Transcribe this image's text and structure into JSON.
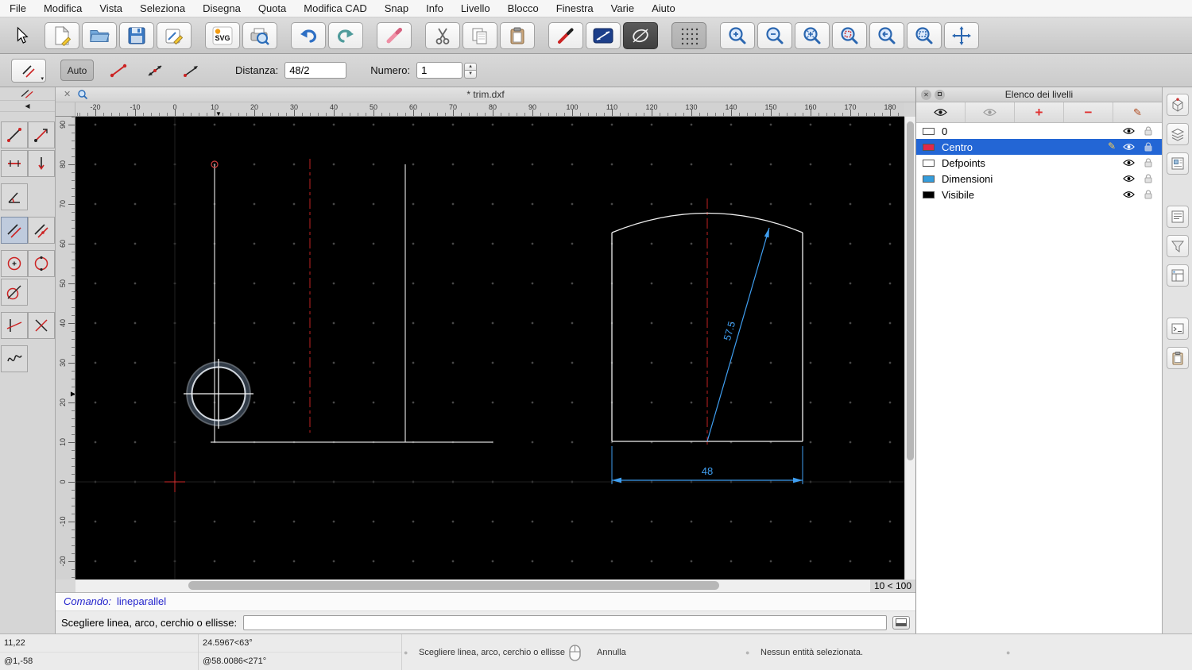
{
  "menubar": {
    "items": [
      "File",
      "Modifica",
      "Vista",
      "Seleziona",
      "Disegna",
      "Quota",
      "Modifica CAD",
      "Snap",
      "Info",
      "Livello",
      "Blocco",
      "Finestra",
      "Varie",
      "Aiuto"
    ]
  },
  "options_toolbar": {
    "auto_label": "Auto",
    "distance_label": "Distanza:",
    "distance_value": "48/2",
    "number_label": "Numero:",
    "number_value": "1"
  },
  "document_tab": {
    "title": "* trim.dxf"
  },
  "rulers": {
    "h_labels": [
      "-20",
      "-10",
      "0",
      "10",
      "20",
      "30",
      "40",
      "50",
      "60",
      "70",
      "80",
      "90",
      "100",
      "110",
      "120",
      "130",
      "140",
      "150",
      "160",
      "170",
      "180"
    ],
    "v_labels": [
      "90",
      "80",
      "70",
      "60",
      "50",
      "40",
      "30",
      "20",
      "10",
      "0",
      "-10",
      "-20"
    ]
  },
  "drawing": {
    "dim_diagonal": "57.5",
    "dim_horizontal": "48"
  },
  "canvas_status": {
    "zoom_range": "10 < 100"
  },
  "layers_panel": {
    "title": "Elenco dei livelli",
    "layers": [
      {
        "name": "0",
        "color": "#ffffff",
        "selected": false
      },
      {
        "name": "Centro",
        "color": "#e0294a",
        "selected": true
      },
      {
        "name": "Defpoints",
        "color": "#ffffff",
        "selected": false
      },
      {
        "name": "Dimensioni",
        "color": "#359ddc",
        "selected": false
      },
      {
        "name": "Visibile",
        "color": "#000000",
        "selected": false
      }
    ]
  },
  "command_panel": {
    "history_label": "Comando:",
    "history_value": "lineparallel",
    "prompt_label": "Scegliere linea, arco, cerchio o ellisse:",
    "input_value": ""
  },
  "status_bar": {
    "coord_abs": "11,22",
    "coord_rel": "@1,-58",
    "polar_abs": "24.5967<63°",
    "polar_rel": "@58.0086<271°",
    "left_hint": "Scegliere linea, arco, cerchio o ellisse",
    "right_hint": "Annulla",
    "selection": "Nessun entità selezionata."
  },
  "icons": {
    "close": "✕",
    "collapse_left": "◀",
    "marker_down": "▼",
    "marker_right": "▶",
    "spin_up": "▲",
    "spin_down": "▼",
    "plus": "+",
    "minus": "−",
    "pencil": "✎",
    "bullet": "●",
    "dropdown": "▾",
    "svg_badge": "SVG"
  }
}
